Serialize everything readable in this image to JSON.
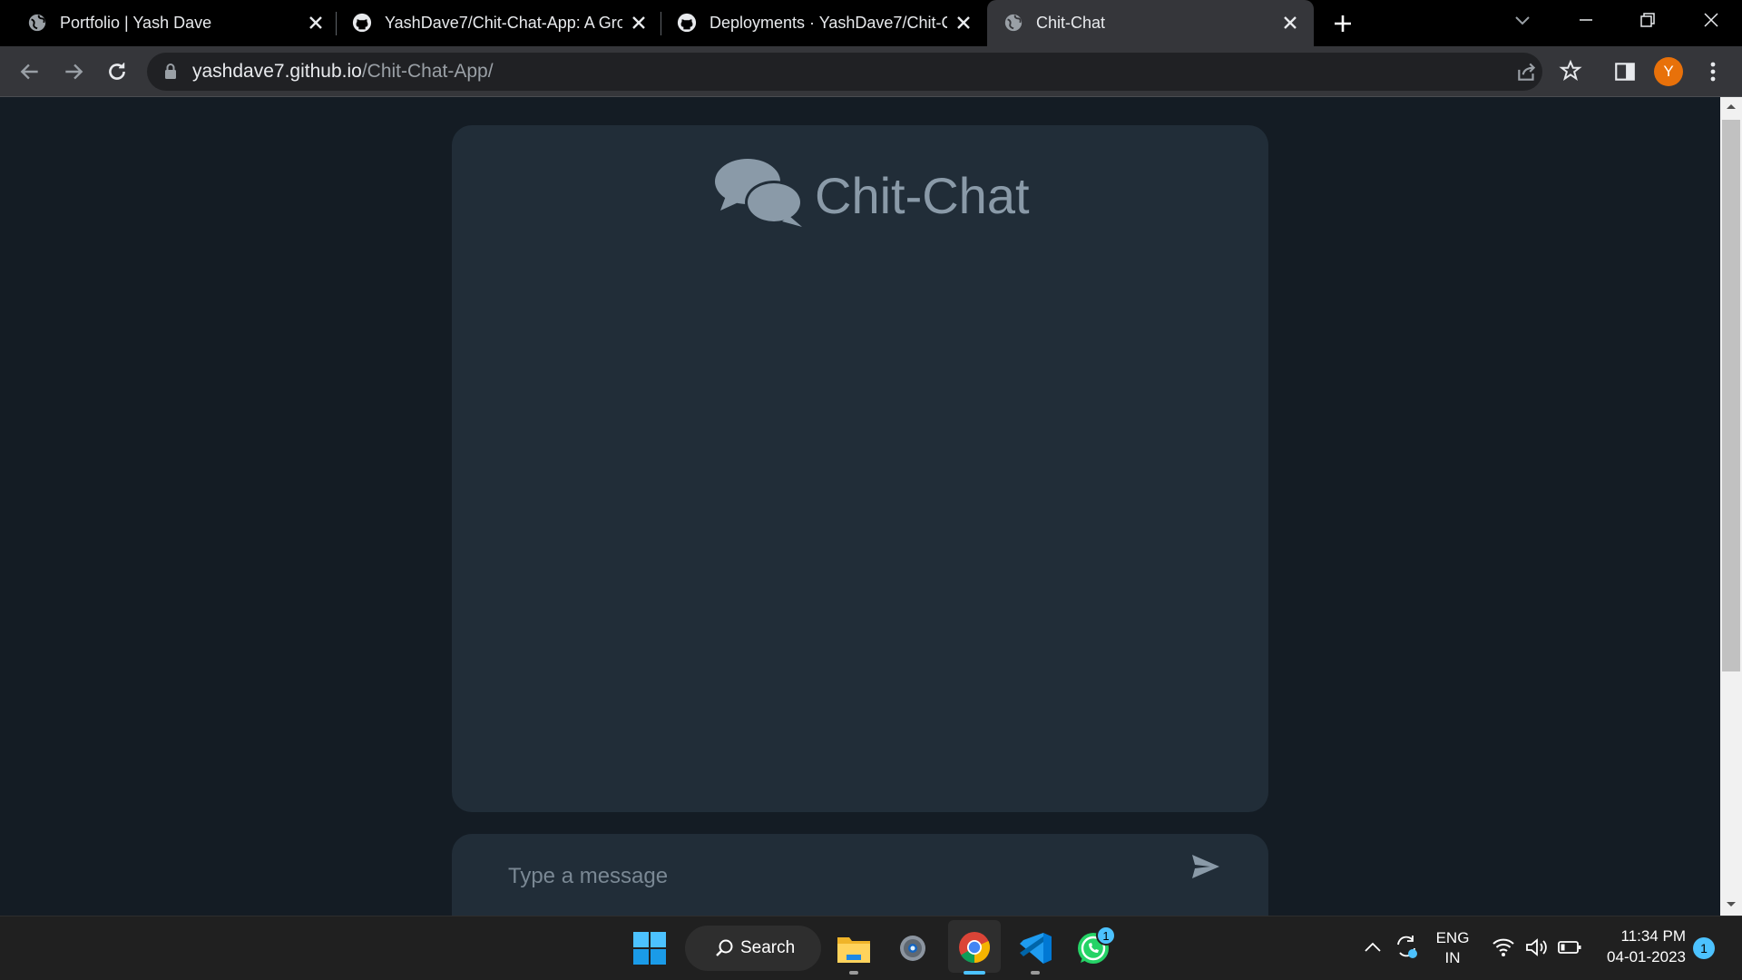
{
  "browser": {
    "tabs": [
      {
        "title": "Portfolio | Yash Dave",
        "icon": "globe-icon",
        "active": false
      },
      {
        "title": "YashDave7/Chit-Chat-App: A Gro",
        "icon": "github-icon",
        "active": false
      },
      {
        "title": "Deployments · YashDave7/Chit-C",
        "icon": "github-icon",
        "active": false
      },
      {
        "title": "Chit-Chat",
        "icon": "globe-icon",
        "active": true
      }
    ],
    "url_host": "yashdave7.github.io",
    "url_path": "/Chit-Chat-App/",
    "profile_initial": "Y",
    "profile_color": "#e8710a"
  },
  "app": {
    "title": "Chit-Chat",
    "logo_icon": "comments-icon",
    "message_placeholder": "Type a message",
    "send_icon": "send-icon",
    "colors": {
      "background": "#141c24",
      "panel": "#212d38",
      "muted_text": "#8a9aa8"
    }
  },
  "taskbar": {
    "search_label": "Search",
    "apps": [
      "windows-start-icon",
      "search-icon",
      "file-explorer-icon",
      "settings-icon",
      "chrome-icon",
      "vscode-icon",
      "whatsapp-icon"
    ],
    "whatsapp_badge": "1",
    "lang_primary": "ENG",
    "lang_secondary": "IN",
    "time": "11:34 PM",
    "date": "04-01-2023",
    "notification_count": "1"
  }
}
